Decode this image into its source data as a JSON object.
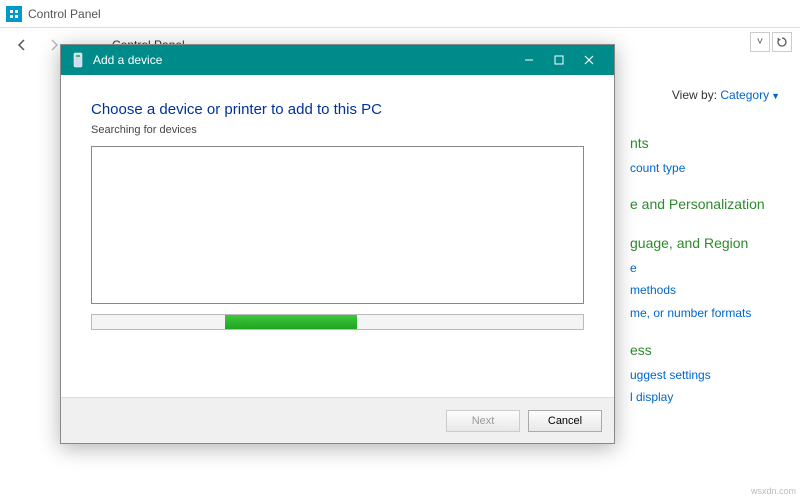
{
  "window": {
    "title": "Control Panel",
    "breadcrumb_root": "Control Panel"
  },
  "viewby": {
    "label": "View by:",
    "mode": "Category"
  },
  "categories": [
    {
      "heading_fragment": "nts",
      "links": [
        "count type"
      ]
    },
    {
      "heading_fragment": "e and Personalization",
      "links": []
    },
    {
      "heading_fragment": "guage, and Region",
      "links": [
        "e",
        "methods",
        "me, or number formats"
      ]
    },
    {
      "heading_fragment": "ess",
      "links": [
        "uggest settings",
        "l display"
      ]
    }
  ],
  "dialog": {
    "title": "Add a device",
    "heading": "Choose a device or printer to add to this PC",
    "subtext": "Searching for devices",
    "progress": {
      "left_pct": 27,
      "width_pct": 27
    },
    "buttons": {
      "next": "Next",
      "cancel": "Cancel"
    }
  },
  "watermark": "wsxdn.com"
}
